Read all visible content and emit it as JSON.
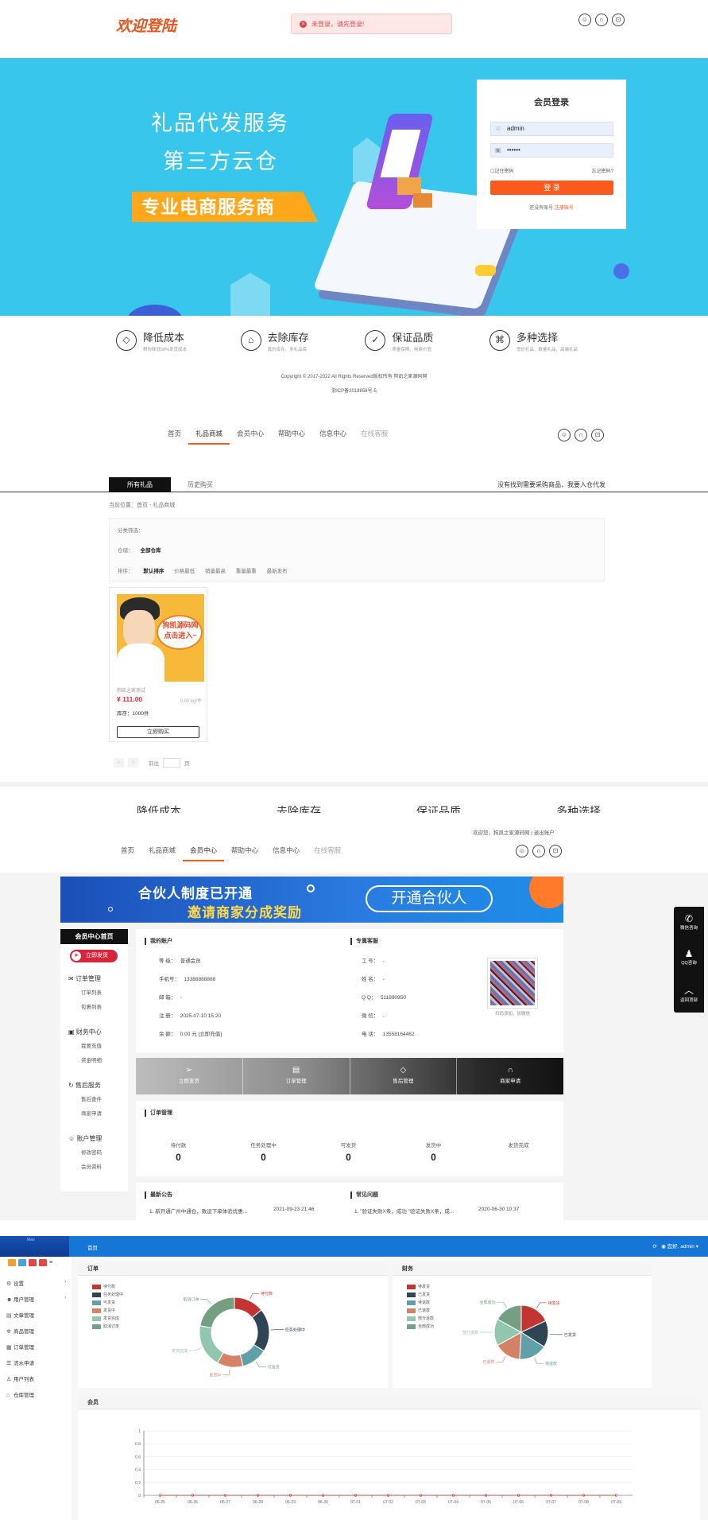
{
  "login_page": {
    "brand": "欢迎登陆",
    "alert": "未登录，请先登录!",
    "banner_line1": "礼品代发服务",
    "banner_line2": "第三方云仓",
    "banner_badge": "专业电商服务商",
    "login_title": "会员登录",
    "username_value": "admin",
    "password_value": "••••••",
    "remember": "记住密码",
    "forgot": "忘记密码?",
    "login_button": "登 录",
    "register_prefix": "还没有账号,",
    "register_link": "注册账号",
    "features": [
      {
        "title": "降低成本",
        "desc": "帮你降低50%发货成本",
        "icon": "diamond-icon"
      },
      {
        "title": "去除库存",
        "desc": "真的库存、多礼品库",
        "icon": "warehouse-icon"
      },
      {
        "title": "保证品质",
        "desc": "质量保障、电商价值",
        "icon": "shield-check-icon"
      },
      {
        "title": "多种选择",
        "desc": "低价礼品、数量礼品、高端礼品",
        "icon": "grid-icon"
      }
    ],
    "copyright": "Copyright © 2017-2022 All Rights Reserved版权所有 狗凯之家源码网",
    "icp": "浙ICP备2018858号-5"
  },
  "shop_page": {
    "nav": [
      "首页",
      "礼品商城",
      "会员中心",
      "帮助中心",
      "信息中心",
      "在线客服"
    ],
    "tab_active": "所有礼品",
    "tab_history": "历史购买",
    "tab_right": "没有找到需要采购商品，我要入仓代发",
    "breadcrumb": "当前位置：首页 - 礼品商城",
    "filter_category": "分类筛选：",
    "filter_warehouse_label": "仓储：",
    "filter_warehouse_value": "全部仓库",
    "filter_sort_label": "排序：",
    "sort_options": [
      "默认排序",
      "价格最低",
      "销量最高",
      "重量最重",
      "最新发布"
    ],
    "product": {
      "image_text_1": "狗凯源码网",
      "image_text_2": "点击进入~",
      "name": "狗凯之家测试",
      "price": "¥ 111.00",
      "weight": "0.00 kg/件",
      "stock": "库存：1000件",
      "buy_button": "立即购买"
    },
    "pager_prefix": "前往",
    "pager_suffix": "页",
    "ghost_features": [
      "降低成本",
      "去除库存",
      "保证品质",
      "多种选择"
    ]
  },
  "member_page": {
    "top_links": "欢迎您，狗凯之家源码网  |  退出账户",
    "nav": [
      "首页",
      "礼品商城",
      "会员中心",
      "帮助中心",
      "信息中心",
      "在线客服"
    ],
    "banner_line1": "合伙人制度已开通",
    "banner_line2": "邀请商家分成奖励",
    "banner_button": "开通合伙人",
    "sidebar_title": "会员中心首页",
    "sidebar_button": "立即发货",
    "groups": [
      {
        "title": "订单管理",
        "items": [
          "订单列表",
          "包裹列表"
        ]
      },
      {
        "title": "财务中心",
        "items": [
          "我要充值",
          "资金明细"
        ]
      },
      {
        "title": "售后服务",
        "items": [
          "售后查件",
          "商家申请"
        ]
      },
      {
        "title": "账户管理",
        "items": [
          "修改密码",
          "会员资料"
        ]
      }
    ],
    "account_title": "我的账户",
    "account": [
      {
        "k": "等    级：",
        "v": "普通会员"
      },
      {
        "k": "手机号：",
        "v": "13388888888"
      },
      {
        "k": "邮    箱：",
        "v": "-"
      },
      {
        "k": "注    册：",
        "v": "2025-07-10 15:20"
      },
      {
        "k": "余    额：",
        "v": "0.00 元  [立即充值]"
      }
    ],
    "service_title": "专属客服",
    "service": [
      {
        "k": "工    号：",
        "v": "-"
      },
      {
        "k": "姓    名：",
        "v": "-"
      },
      {
        "k": "Q    Q：",
        "v": "511890950"
      },
      {
        "k": "微    信：",
        "v": "-"
      },
      {
        "k": "电    话：",
        "v": "13558164462"
      }
    ],
    "qr_caption": "扫码添加，加微信",
    "action_bar": [
      {
        "label": "立即发货",
        "icon": "send-icon"
      },
      {
        "label": "订单管理",
        "icon": "list-icon"
      },
      {
        "label": "售后管理",
        "icon": "diamond-icon"
      },
      {
        "label": "商家申请",
        "icon": "headset-icon"
      }
    ],
    "order_title": "订单管理",
    "order_stats": [
      {
        "label": "待付款",
        "value": "0"
      },
      {
        "label": "任务处理中",
        "value": "0"
      },
      {
        "label": "可发货",
        "value": "0"
      },
      {
        "label": "发货中",
        "value": "0"
      },
      {
        "label": "发货完成",
        "value": ""
      }
    ],
    "notice_title": "最新公告",
    "notice_item": "1. 新开通广州中通仓，致运下单体验优惠...",
    "notice_date": "2021-09-23 21:46",
    "faq_title": "常见问题",
    "faq_item": "1. \"验证失败X条，成功 \"验证失败X条，成...",
    "faq_date": "2020-06-30 10:37",
    "float_bar": [
      {
        "label": "微信咨询",
        "icon": "wechat-icon"
      },
      {
        "label": "QQ咨询",
        "icon": "qq-icon"
      },
      {
        "label": "返回顶部",
        "icon": "chevron-up-icon"
      }
    ]
  },
  "admin_page": {
    "logo_text": "Mao",
    "home": "首页",
    "user": "您好, admin ▾",
    "menu": [
      {
        "label": "设置",
        "icon": "gear-icon",
        "arrow": true
      },
      {
        "label": "用户管理",
        "icon": "users-icon",
        "arrow": true
      },
      {
        "label": "文章管理",
        "icon": "article-icon",
        "arrow": false
      },
      {
        "label": "商品管理",
        "icon": "box-icon",
        "arrow": false
      },
      {
        "label": "订单管理",
        "icon": "order-icon",
        "arrow": false
      },
      {
        "label": "流水申请",
        "icon": "flow-icon",
        "arrow": false
      },
      {
        "label": "用户列表",
        "icon": "user-list-icon",
        "arrow": false
      },
      {
        "label": "仓库管理",
        "icon": "warehouse-icon",
        "arrow": false
      }
    ],
    "order_card_title": "订单",
    "finance_card_title": "财务",
    "member_card_title": "会员",
    "order_legend": [
      "待付款",
      "任务处理中",
      "可发货",
      "发货中",
      "发货完成",
      "取消订单"
    ],
    "finance_legend": [
      "待发货",
      "已发货",
      "待退款",
      "已退款",
      "部分退款",
      "全部成功"
    ]
  },
  "chart_data": [
    {
      "type": "pie",
      "categories": [
        "待付款",
        "任务处理中",
        "可发货",
        "发货中",
        "发货完成",
        "取消订单"
      ],
      "values": [
        14,
        20,
        12,
        12,
        20,
        22
      ],
      "colors": [
        "#c23531",
        "#2f4554",
        "#61a0a8",
        "#d48265",
        "#91c7ae",
        "#749f83"
      ],
      "title": "订单"
    },
    {
      "type": "pie",
      "categories": [
        "待发货",
        "已发货",
        "待退款",
        "已退款",
        "部分退款",
        "全部成功"
      ],
      "values": [
        18,
        16,
        17,
        16,
        16,
        17
      ],
      "colors": [
        "#c23531",
        "#2f4554",
        "#61a0a8",
        "#d48265",
        "#91c7ae",
        "#749f83"
      ],
      "title": "财务"
    },
    {
      "type": "line",
      "title": "会员",
      "categories": [
        "06-25",
        "06-26",
        "06-27",
        "06-28",
        "06-29",
        "06-30",
        "07-01",
        "07-02",
        "07-03",
        "07-04",
        "07-05",
        "07-06",
        "07-07",
        "07-08",
        "07-09"
      ],
      "values": [
        0,
        0,
        0,
        0,
        0,
        0,
        0,
        0,
        0,
        0,
        0,
        0,
        0,
        0,
        0
      ],
      "yticks": [
        "0",
        "0.2",
        "0.4",
        "0.6",
        "0.8",
        "1"
      ],
      "ylim": [
        0,
        1
      ]
    }
  ],
  "colors": {
    "accent": "#fb5a1e",
    "banner": "#38c6ec",
    "admin_bar": "#1576d6"
  }
}
